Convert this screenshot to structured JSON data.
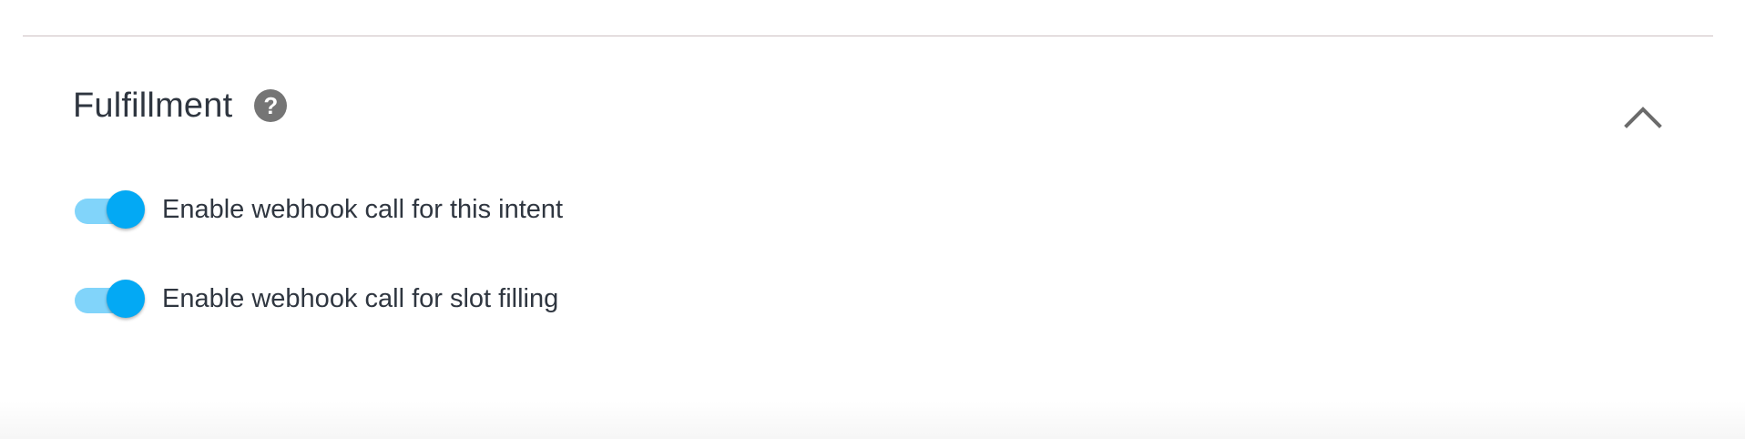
{
  "fulfillment": {
    "title": "Fulfillment",
    "help_icon": "question-circle-icon",
    "collapse_icon": "chevron-up-icon",
    "expanded": true,
    "toggles": [
      {
        "label": "Enable webhook call for this intent",
        "enabled": true
      },
      {
        "label": "Enable webhook call for slot filling",
        "enabled": true
      }
    ]
  },
  "colors": {
    "toggle_thumb": "#03a9f4",
    "toggle_track": "#81d4fa",
    "text": "#2f3640",
    "icon": "#757575"
  }
}
